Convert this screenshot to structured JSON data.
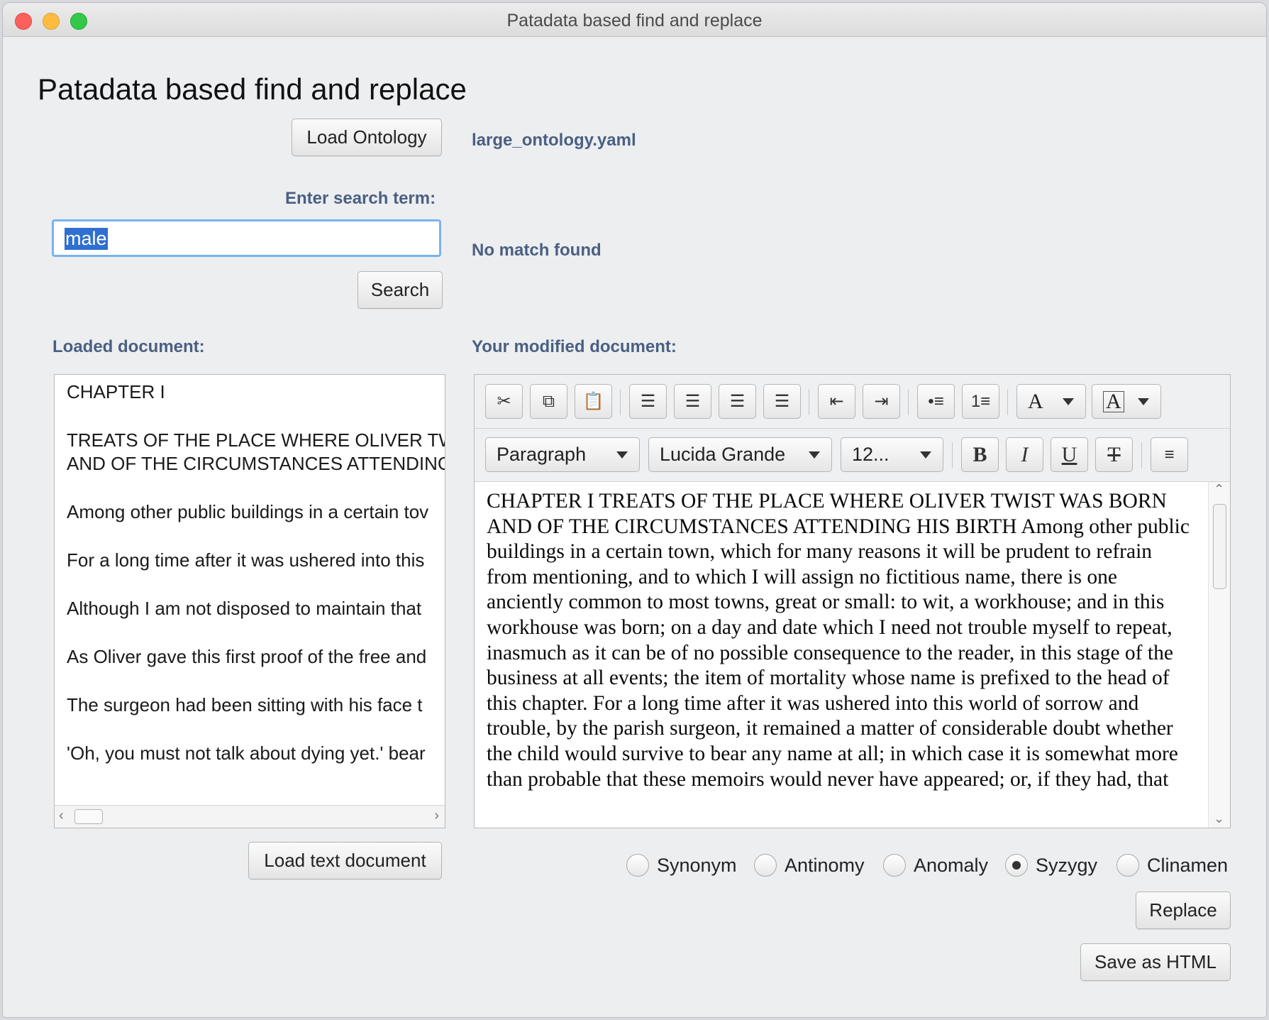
{
  "window": {
    "title": "Patadata based find and replace"
  },
  "heading": "Patadata based find and replace",
  "ontology": {
    "button_label": "Load Ontology",
    "filename": "large_ontology.yaml"
  },
  "search": {
    "label": "Enter search term:",
    "value": "male",
    "button_label": "Search",
    "status": "No match found"
  },
  "loaded_document": {
    "label": "Loaded document:",
    "lines": [
      "CHAPTER I",
      "TREATS OF THE PLACE WHERE OLIVER TW",
      "AND OF THE CIRCUMSTANCES ATTENDING",
      "Among other public buildings in a certain tov",
      "For a long time after it was ushered into this",
      "Although I am not disposed to maintain that",
      "As Oliver gave this first proof of the free and",
      "The surgeon had been sitting with his face t",
      "'Oh, you must not talk about dying yet.' bear"
    ],
    "load_button_label": "Load text document"
  },
  "modified_document": {
    "label": "Your modified document:",
    "format": {
      "block": "Paragraph",
      "font": "Lucida Grande",
      "size": "12..."
    },
    "text": "CHAPTER I TREATS OF THE PLACE WHERE OLIVER TWIST WAS BORN AND OF THE CIRCUMSTANCES ATTENDING HIS BIRTH Among other public buildings in a certain town, which for many reasons it will be prudent to refrain from mentioning, and to which I will assign no fictitious name, there is one anciently common to most towns, great or small: to wit, a workhouse; and in this workhouse was born; on a day and date which I need not trouble myself to repeat, inasmuch as it can be of no possible consequence to the reader, in this stage of the business at all events; the item of mortality whose name is prefixed to the head of this chapter. For a long time after it was ushered into this world of sorrow and trouble, by the parish surgeon, it remained a matter of considerable doubt whether the child would survive to bear any name at all; in which case it is somewhat more than probable that these memoirs would never have appeared; or, if they had, that"
  },
  "toolbar": {
    "bold": "B",
    "italic": "I",
    "underline": "U",
    "strike": "T",
    "font_color_glyph": "A",
    "bg_color_glyph": "A"
  },
  "options": {
    "items": [
      "Synonym",
      "Antinomy",
      "Anomaly",
      "Syzygy",
      "Clinamen"
    ],
    "selected": "Syzygy"
  },
  "actions": {
    "replace_label": "Replace",
    "save_label": "Save as HTML"
  }
}
